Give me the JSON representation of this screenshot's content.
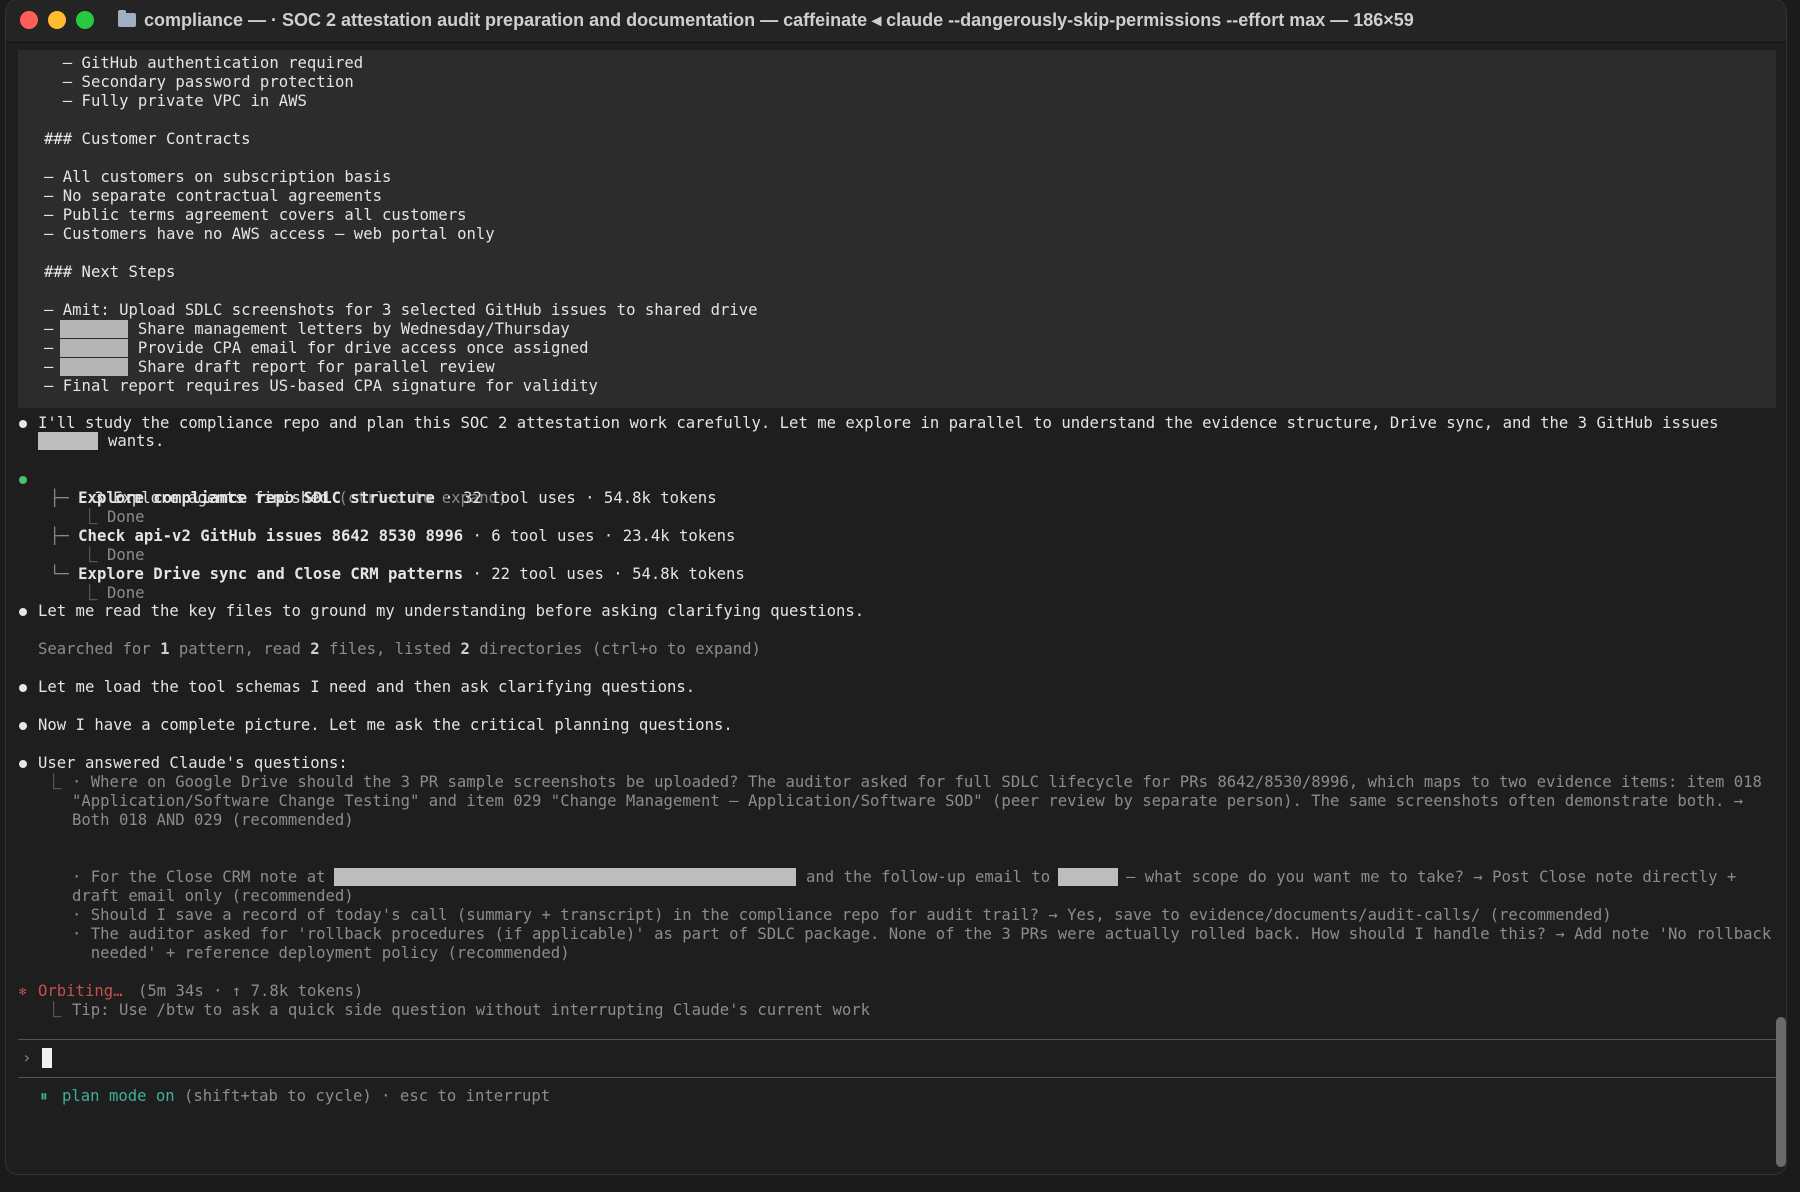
{
  "window": {
    "title": "compliance — · SOC 2 attestation audit preparation and documentation — caffeinate ◂ claude --dangerously-skip-permissions --effort max — 186×59",
    "colors": {
      "close": "#ff5f57",
      "minimize": "#febc2e",
      "zoom": "#28c840"
    }
  },
  "note": [
    "  – GitHub authentication required",
    "  – Secondary password protection",
    "  – Fully private VPC in AWS",
    "",
    "### Customer Contracts",
    "",
    "– All customers on subscription basis",
    "– No separate contractual agreements",
    "– Public terms agreement covers all customers",
    "– Customers have no AWS access – web portal only",
    "",
    "### Next Steps",
    "",
    "– Amit: Upload SDLC screenshots for 3 selected GitHub issues to shared drive",
    "–         Share management letters by Wednesday/Thursday",
    "–         Provide CPA email for drive access once assigned",
    "–         Share draft report for parallel review",
    "– Final report requires US-based CPA signature for validity"
  ],
  "msg1": {
    "line1": "I'll study the compliance repo and plan this SOC 2 attestation work carefully. Let me explore in parallel to understand the evidence structure, Drive sync, and the 3 GitHub issues",
    "line2": "wants."
  },
  "agents": {
    "header": "3 Explore agents finished",
    "hint": "(ctrl+o to expand)",
    "items": [
      {
        "name": "Explore compliance repo SDLC structure",
        "stats": " · 32 tool uses · 54.8k tokens",
        "status": "Done"
      },
      {
        "name": "Check api-v2 GitHub issues 8642 8530 8996",
        "stats": " · 6 tool uses · 23.4k tokens",
        "status": "Done"
      },
      {
        "name": "Explore Drive sync and Close CRM patterns",
        "stats": " · 22 tool uses · 54.8k tokens",
        "status": "Done"
      }
    ]
  },
  "msg2": "Let me read the key files to ground my understanding before asking clarifying questions.",
  "searched": {
    "a": "Searched for ",
    "n1": "1",
    "b": " pattern, read ",
    "n2": "2",
    "c": " files, listed ",
    "n3": "2",
    "d": " directories (ctrl+o to expand)"
  },
  "msg3": "Let me load the tool schemas I need and then ask clarifying questions.",
  "msg4": "Now I have a complete picture. Let me ask the critical planning questions.",
  "answers": {
    "header": "User answered Claude's questions:",
    "lines": [
      "· Where on Google Drive should the 3 PR sample screenshots be uploaded? The auditor asked for full SDLC lifecycle for PRs 8642/8530/8996, which maps to two evidence items: item 018",
      "\"Application/Software Change Testing\" and item 029 \"Change Management – Application/Software SOD\" (peer review by separate person). The same screenshots often demonstrate both. →",
      "Both 018 AND 029 (recommended)"
    ],
    "crm_a": "· For the Close CRM note at",
    "crm_b": "and the follow-up email to",
    "crm_c": "– what scope do you want me to take? → Post Close note directly +",
    "crm_d": "draft email only (recommended)",
    "rest": [
      "· Should I save a record of today's call (summary + transcript) in the compliance repo for audit trail? → Yes, save to evidence/documents/audit-calls/ (recommended)",
      "· The auditor asked for 'rollback procedures (if applicable)' as part of SDLC package. None of the 3 PRs were actually rolled back. How should I handle this? → Add note 'No rollback",
      "  needed' + reference deployment policy (recommended)"
    ]
  },
  "status": {
    "spinner": "Orbiting…",
    "stats": "(5m 34s · ↑ 7.8k tokens)",
    "tip": "Tip: Use /btw to ask a quick side question without interrupting Claude's current work"
  },
  "prompt": {
    "chevron": "›",
    "value": ""
  },
  "footer": {
    "mode": "plan mode on",
    "rest": "(shift+tab to cycle) · esc to interrupt"
  }
}
